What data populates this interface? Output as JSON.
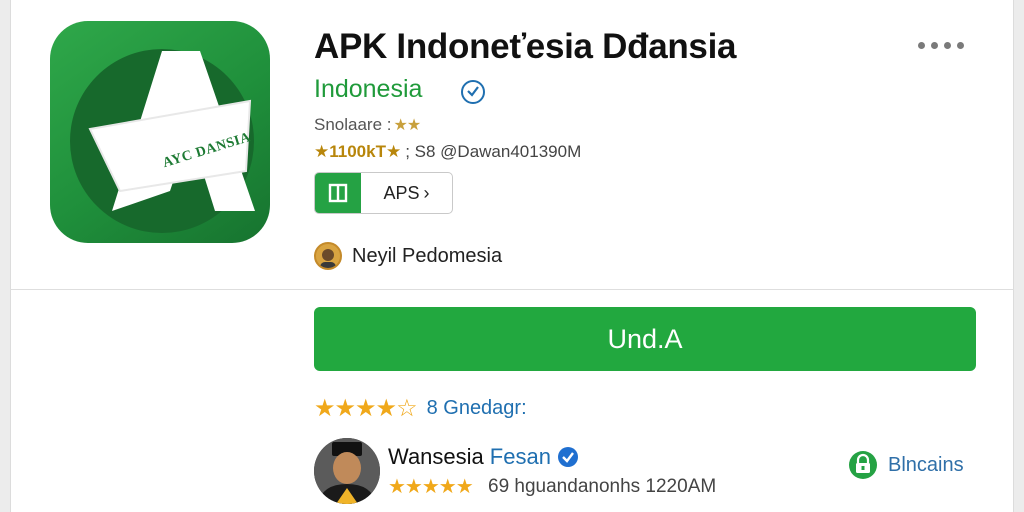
{
  "app": {
    "title": "APK Indoneťesia Dđansia",
    "developer": "Indonesia",
    "icon_text": "AYC DANSIA",
    "category_label": "Snolaare :",
    "category_stars": "★★",
    "rating_lead": "★1100kT★",
    "rating_rest": "; S8 @Dawan401390M",
    "chip_label": "APS",
    "chip_arrow": "›"
  },
  "publisher": {
    "name": "Neyil Pedomesia"
  },
  "install": {
    "label": "Und.A"
  },
  "rating": {
    "stars_filled": "★★★★",
    "stars_empty": "☆",
    "count_label": "8 Gnedagr:"
  },
  "review": {
    "first_name": "Wansesia",
    "last_name": "Fesan",
    "stars": "★★★★★",
    "date": "69 hguandanonhs 1220AM"
  },
  "action": {
    "label": "Blncains"
  },
  "colors": {
    "brand_green": "#22a83f",
    "link_blue": "#1f6fb0",
    "star": "#f0a81a"
  },
  "icons": [
    "app-logo",
    "more-dots-icon",
    "verified-badge-icon",
    "app-category-icon",
    "publisher-avatar",
    "reviewer-avatar",
    "verified-check-icon",
    "lock-icon"
  ]
}
